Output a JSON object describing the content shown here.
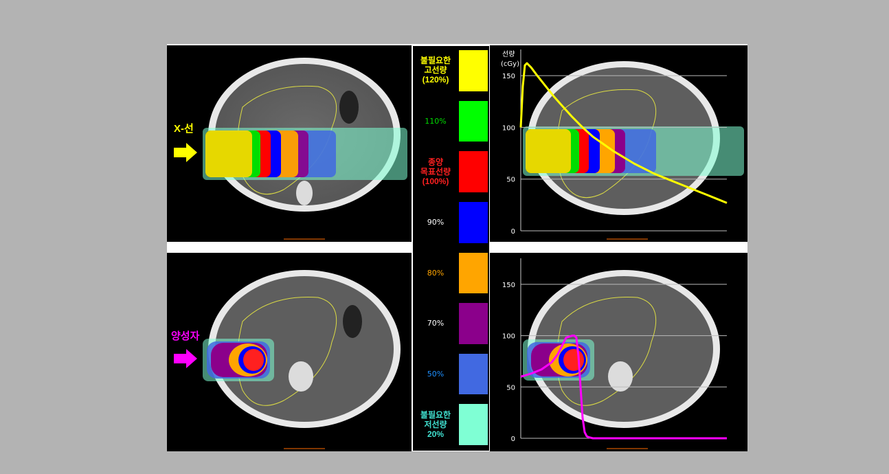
{
  "beams": {
    "xray_label": "X-선",
    "proton_label": "양성자",
    "xray_color": "#ffff00",
    "proton_color": "#ff00ff"
  },
  "legend": {
    "items": [
      {
        "lines": [
          "불필요한",
          "고선량",
          "(120%)"
        ],
        "color": "#ffff00",
        "text_color": "#ffff00",
        "bold": true
      },
      {
        "lines": [
          "110%"
        ],
        "color": "#00ff00",
        "text_color": "#00dd00",
        "bold": false
      },
      {
        "lines": [
          "종양",
          "목표선량",
          "(100%)"
        ],
        "color": "#ff0000",
        "text_color": "#ff2020",
        "bold": true
      },
      {
        "lines": [
          "90%"
        ],
        "color": "#0000ff",
        "text_color": "#ffffff",
        "bold": false
      },
      {
        "lines": [
          "80%"
        ],
        "color": "#ffa500",
        "text_color": "#ffa500",
        "bold": false
      },
      {
        "lines": [
          "70%"
        ],
        "color": "#8b008b",
        "text_color": "#ffffff",
        "bold": false
      },
      {
        "lines": [
          "50%"
        ],
        "color": "#4169e1",
        "text_color": "#1e90ff",
        "bold": false
      },
      {
        "lines": [
          "불필요한",
          "저선량",
          "20%"
        ],
        "color": "#7fffd4",
        "text_color": "#40e0d0",
        "bold": true
      }
    ]
  },
  "chart_data": [
    {
      "type": "line",
      "title": "",
      "ylabel_lines": [
        "선량",
        "(cGy)"
      ],
      "xlabel": "",
      "yticks": [
        0,
        50,
        100,
        150
      ],
      "ylim": [
        0,
        170
      ],
      "xlim": [
        0,
        100
      ],
      "series": [
        {
          "color": "#ffff00",
          "x": [
            0,
            1,
            2,
            3,
            5,
            8,
            12,
            16,
            20,
            25,
            30,
            35,
            40,
            45,
            50,
            55,
            60,
            65,
            70,
            75,
            80,
            85,
            90,
            95,
            100
          ],
          "y": [
            100,
            140,
            160,
            162,
            158,
            150,
            140,
            130,
            121,
            110,
            100,
            91,
            84,
            77,
            71,
            65,
            60,
            55,
            51,
            47,
            43,
            39,
            35,
            31,
            27
          ]
        }
      ]
    },
    {
      "type": "line",
      "title": "",
      "ylabel_lines": [],
      "xlabel": "",
      "yticks": [
        0,
        50,
        100,
        150
      ],
      "ylim": [
        0,
        170
      ],
      "xlim": [
        0,
        100
      ],
      "series": [
        {
          "color": "#ff00ff",
          "x": [
            0,
            5,
            10,
            15,
            18,
            20,
            22,
            25,
            26,
            27,
            28,
            29,
            30,
            31,
            32,
            33,
            35,
            40,
            50,
            60,
            80,
            100
          ],
          "y": [
            60,
            63,
            67,
            74,
            82,
            90,
            98,
            100,
            100,
            98,
            80,
            50,
            20,
            6,
            2,
            1,
            0,
            0,
            0,
            0,
            0,
            0
          ]
        }
      ]
    }
  ]
}
